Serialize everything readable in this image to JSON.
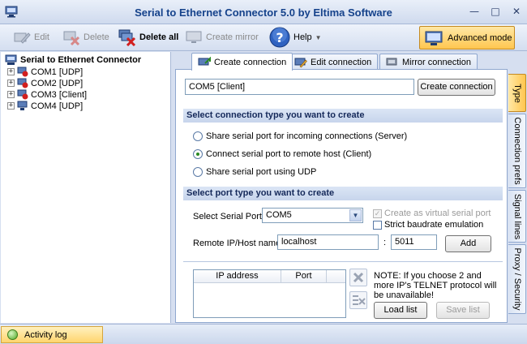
{
  "window": {
    "title": "Serial to Ethernet Connector 5.0 by Eltima Software"
  },
  "toolbar": {
    "edit": "Edit",
    "delete": "Delete",
    "delete_all": "Delete all",
    "create_mirror": "Create mirror",
    "help": "Help",
    "advanced_mode": "Advanced mode"
  },
  "tree": {
    "root": "Serial to Ethernet Connector",
    "items": [
      {
        "label": "COM1 [UDP]"
      },
      {
        "label": "COM2 [UDP]"
      },
      {
        "label": "COM3 [Client]"
      },
      {
        "label": "COM4 [UDP]"
      }
    ]
  },
  "tabs": [
    {
      "label": "Create connection",
      "active": true
    },
    {
      "label": "Edit connection",
      "active": false
    },
    {
      "label": "Mirror connection",
      "active": false
    }
  ],
  "form": {
    "connection_name": "COM5 [Client]",
    "create_button": "Create connection",
    "section_type": "Select connection type you want to create",
    "radio_server": "Share serial port for incoming connections (Server)",
    "radio_client": "Connect serial port to remote host (Client)",
    "radio_udp": "Share serial port using UDP",
    "selected_radio": "client",
    "section_port": "Select port type you want to create",
    "serial_port_label": "Select Serial Port:",
    "serial_port_value": "COM5",
    "virtual_port_label": "Create as virtual serial port",
    "virtual_port_checked": true,
    "strict_baud_label": "Strict baudrate emulation",
    "strict_baud_checked": false,
    "remote_host_label": "Remote IP/Host name:",
    "remote_host_value": "localhost",
    "colon": ":",
    "port_value": "5011",
    "add_button": "Add",
    "ip_col": "IP address",
    "port_col": "Port",
    "note": "NOTE: If you choose 2 and more IP's TELNET protocol will be unavailable!",
    "load_list": "Load list",
    "save_list": "Save list"
  },
  "side_tabs": [
    {
      "label": "Type",
      "active": true
    },
    {
      "label": "Connection prefs",
      "active": false
    },
    {
      "label": "Signal lines",
      "active": false
    },
    {
      "label": "Proxy / Security",
      "active": false
    }
  ],
  "status": {
    "activity_log": "Activity log"
  }
}
